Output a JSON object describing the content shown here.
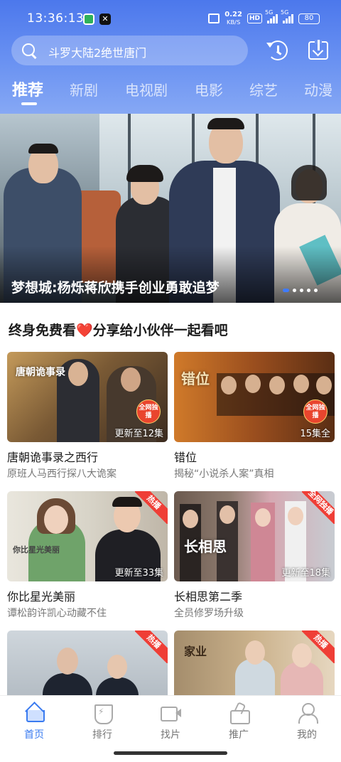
{
  "status_bar": {
    "time": "13:36:13",
    "speed_value": "0.22",
    "speed_unit": "KB/S",
    "hd_label": "HD",
    "network_1": "5G",
    "network_2": "5G",
    "battery": "80"
  },
  "search": {
    "placeholder": "斗罗大陆2绝世唐门"
  },
  "header_icons": [
    "history-icon",
    "download-icon"
  ],
  "tabs": [
    {
      "label": "推荐",
      "active": true
    },
    {
      "label": "新剧",
      "active": false
    },
    {
      "label": "电视剧",
      "active": false
    },
    {
      "label": "电影",
      "active": false
    },
    {
      "label": "综艺",
      "active": false
    },
    {
      "label": "动漫",
      "active": false
    }
  ],
  "banner": {
    "title": "梦想城:杨烁蒋欣携手创业勇敢追梦",
    "slide_count": 5,
    "active_slide": 1
  },
  "section": {
    "title": "终身免费看❤️分享给小伙伴一起看吧"
  },
  "cards": [
    {
      "title": "唐朝诡事录之西行",
      "subtitle": "原班人马西行探八大诡案",
      "episode": "更新至12集",
      "badge": "全网独播",
      "logo": "唐朝诡事录"
    },
    {
      "title": "错位",
      "subtitle": "揭秘“小说杀人案”真相",
      "episode": "15集全",
      "badge": "全网独播",
      "logo": "错位"
    },
    {
      "title": "你比星光美丽",
      "subtitle": "谭松韵许凯心动藏不住",
      "episode": "更新至33集",
      "badge": "热播",
      "logo": "你比星光美丽"
    },
    {
      "title": "长相思第二季",
      "subtitle": "全员修罗场升级",
      "episode": "更新至18集",
      "badge": "全网独播",
      "logo": "长相思"
    },
    {
      "title": "",
      "subtitle": "",
      "episode": "",
      "badge": "热播",
      "logo": ""
    },
    {
      "title": "",
      "subtitle": "",
      "episode": "",
      "badge": "热播",
      "logo": "家业"
    }
  ],
  "bottom_nav": [
    {
      "label": "首页",
      "icon": "home-icon",
      "active": true
    },
    {
      "label": "排行",
      "icon": "rank-icon",
      "active": false
    },
    {
      "label": "找片",
      "icon": "film-icon",
      "active": false
    },
    {
      "label": "推广",
      "icon": "promo-icon",
      "active": false
    },
    {
      "label": "我的",
      "icon": "me-icon",
      "active": false
    }
  ],
  "colors": {
    "header_top": "#4c78ec",
    "header_bottom": "#86a8f4",
    "accent": "#3a7bf0",
    "badge_red": "#ef3e36"
  }
}
